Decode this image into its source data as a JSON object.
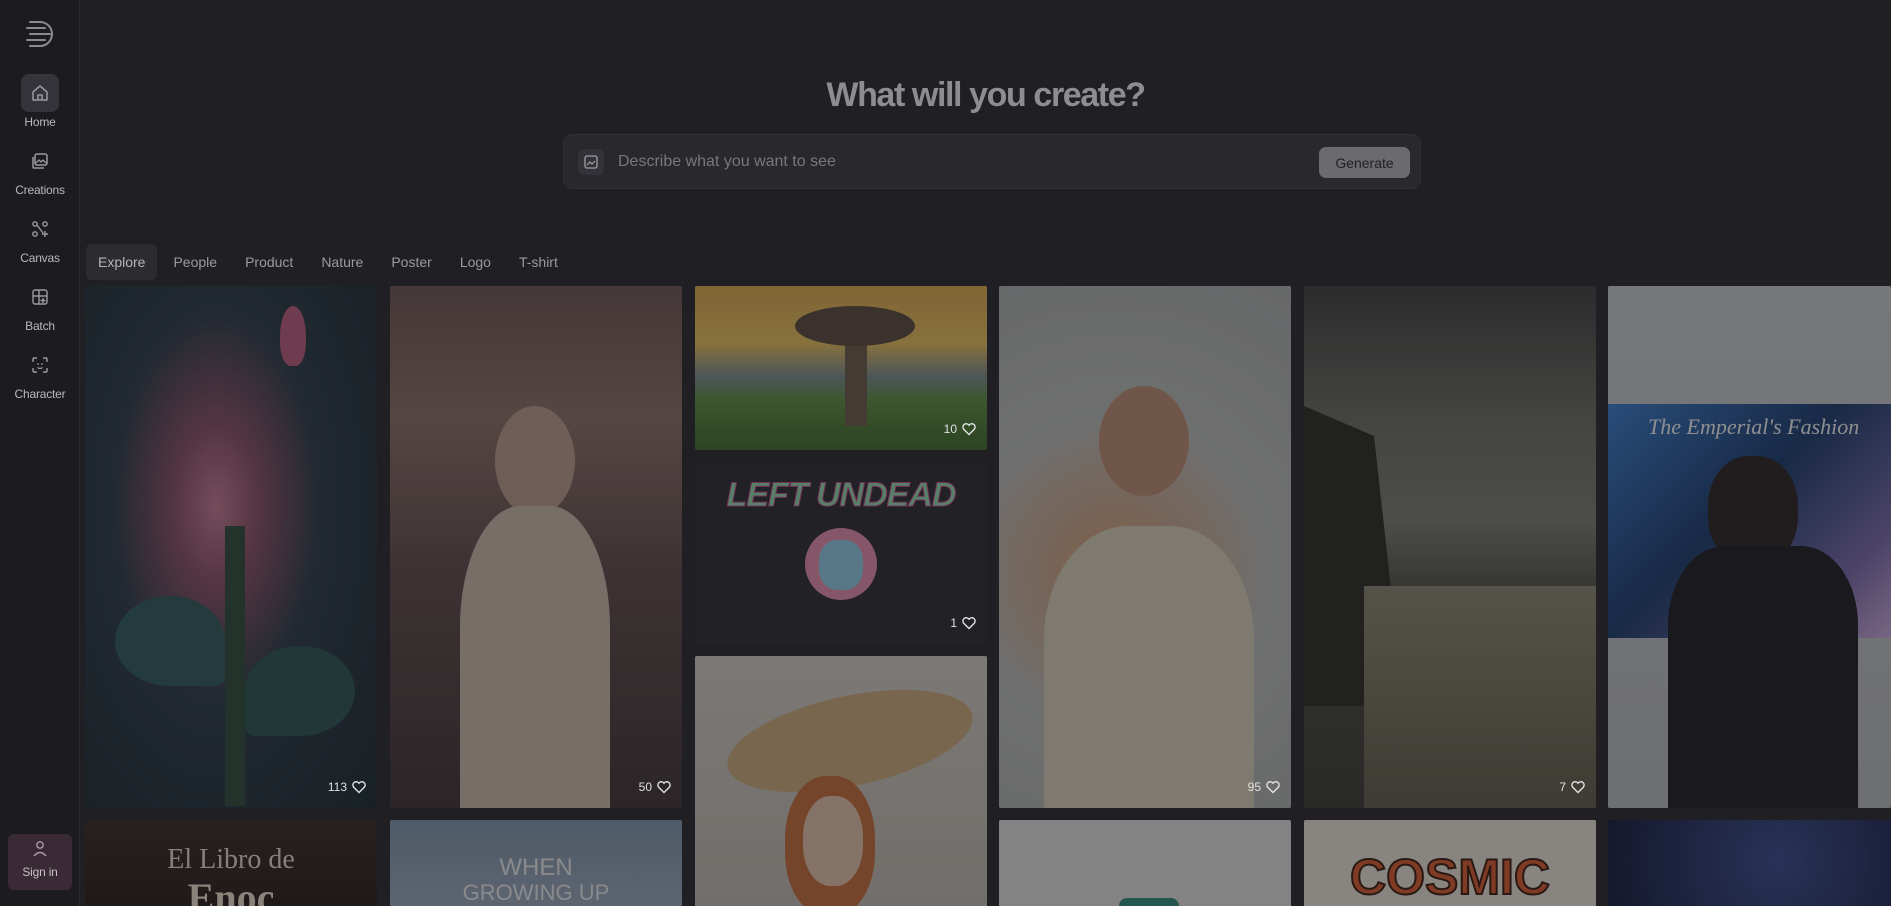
{
  "sidebar": {
    "items": [
      {
        "label": "Home",
        "icon": "home-icon"
      },
      {
        "label": "Creations",
        "icon": "image-stack-icon"
      },
      {
        "label": "Canvas",
        "icon": "canvas-icon"
      },
      {
        "label": "Batch",
        "icon": "batch-icon"
      },
      {
        "label": "Character",
        "icon": "character-icon"
      }
    ],
    "signin_label": "Sign in"
  },
  "header": {
    "title": "What will you create?",
    "search_placeholder": "Describe what you want to see",
    "generate_label": "Generate"
  },
  "tabs": [
    "Explore",
    "People",
    "Product",
    "Nature",
    "Poster",
    "Logo",
    "T-shirt"
  ],
  "gallery": [
    {
      "subject": "Pink flower",
      "likes": "113"
    },
    {
      "subject": "Girl in meadow",
      "likes": "50"
    },
    {
      "subject": "Baobab tree",
      "likes": "10"
    },
    {
      "subject": "Left Undead",
      "likes": "1",
      "text": "LEFT UNDEAD"
    },
    {
      "subject": "Woman with hat",
      "likes": ""
    },
    {
      "subject": "Man in sweater",
      "likes": "95"
    },
    {
      "subject": "Stormy sea",
      "likes": "7"
    },
    {
      "subject": "Fashion man",
      "likes": "",
      "text": "The Emperial's Fashion"
    },
    {
      "subject": "Book cover",
      "text1": "El Libro de",
      "text2": "Enoc"
    },
    {
      "subject": "Poster",
      "text1": "WHEN",
      "text2": "GROWING UP"
    },
    {
      "subject": "Cosmic",
      "text": "COSMIC"
    }
  ],
  "colors": {
    "accent_signin": "#3a2a36",
    "background": "#202024",
    "sidebar": "#1c1c20"
  }
}
